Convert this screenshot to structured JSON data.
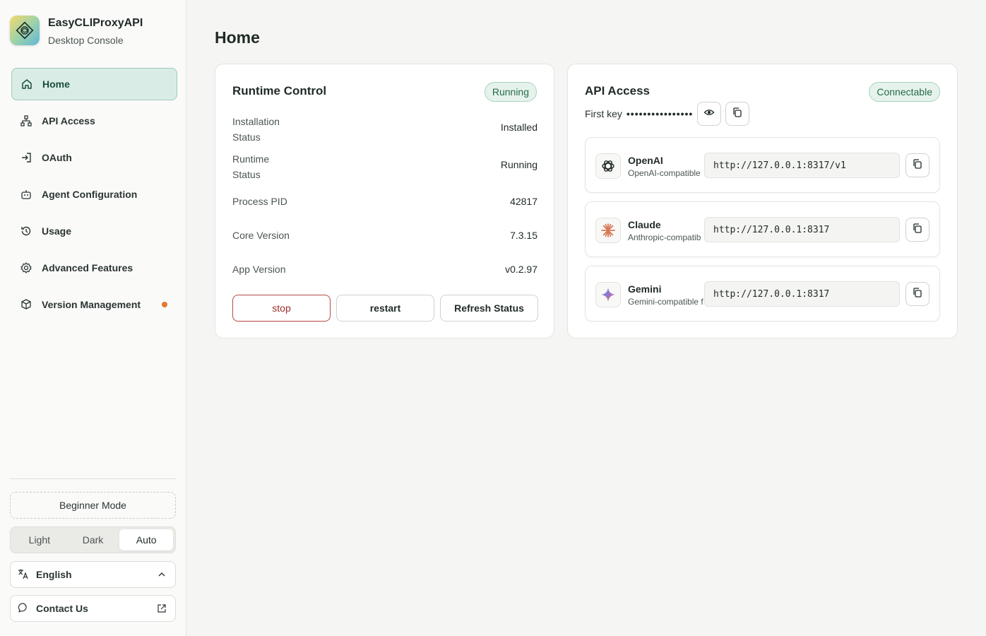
{
  "app": {
    "title": "EasyCLIProxyAPI",
    "subtitle": "Desktop Console"
  },
  "sidebar": {
    "items": [
      {
        "label": "Home",
        "icon": "home-icon",
        "active": true
      },
      {
        "label": "API Access",
        "icon": "network-icon"
      },
      {
        "label": "OAuth",
        "icon": "login-icon"
      },
      {
        "label": "Agent Configuration",
        "icon": "robot-icon"
      },
      {
        "label": "Usage",
        "icon": "history-icon"
      },
      {
        "label": "Advanced Features",
        "icon": "gear-icon"
      },
      {
        "label": "Version Management",
        "icon": "package-icon",
        "badge": "update-dot"
      }
    ],
    "mode_button": "Beginner Mode",
    "theme": {
      "options": [
        "Light",
        "Dark",
        "Auto"
      ],
      "selected": "Auto"
    },
    "language": "English",
    "contact": "Contact Us"
  },
  "page": {
    "title": "Home"
  },
  "runtime": {
    "title": "Runtime Control",
    "status_badge": "Running",
    "rows": [
      {
        "label_line1": "Installation",
        "label_line2": "Status",
        "value": "Installed"
      },
      {
        "label_line1": "Runtime",
        "label_line2": "Status",
        "value": "Running"
      },
      {
        "label": "Process PID",
        "value": "42817"
      },
      {
        "label": "Core Version",
        "value": "7.3.15"
      },
      {
        "label": "App Version",
        "value": "v0.2.97"
      }
    ],
    "buttons": {
      "stop": "stop",
      "restart": "restart",
      "refresh": "Refresh Status"
    }
  },
  "api_access": {
    "title": "API Access",
    "status_badge": "Connectable",
    "key_label": "First key",
    "key_mask": "••••••••••••••••",
    "providers": [
      {
        "name": "OpenAI",
        "subtitle": "OpenAI-compatible",
        "url": "http://127.0.0.1:8317/v1",
        "icon": "openai-icon"
      },
      {
        "name": "Claude",
        "subtitle": "Anthropic-compatib",
        "url": "http://127.0.0.1:8317",
        "icon": "claude-icon"
      },
      {
        "name": "Gemini",
        "subtitle": "Gemini-compatible f",
        "url": "http://127.0.0.1:8317",
        "icon": "gemini-icon"
      }
    ]
  },
  "colors": {
    "accent": "#d9ede6",
    "accent_border": "#9ccbb9",
    "badge_green": "#256b47",
    "danger": "#9b2f2a",
    "update_dot": "#e07a2e"
  }
}
